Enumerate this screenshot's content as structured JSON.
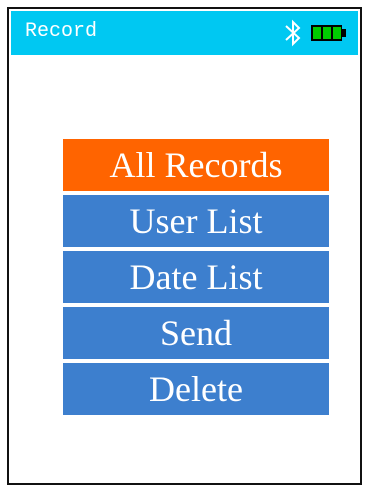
{
  "header": {
    "title": "Record",
    "icons": [
      "bluetooth-icon",
      "battery-icon"
    ]
  },
  "menu": {
    "items": [
      {
        "label": "All Records",
        "selected": true
      },
      {
        "label": "User List",
        "selected": false
      },
      {
        "label": "Date List",
        "selected": false
      },
      {
        "label": "Send",
        "selected": false
      },
      {
        "label": "Delete",
        "selected": false
      }
    ]
  },
  "battery": {
    "level": 1.0
  },
  "colors": {
    "status_bar": "#00c8f2",
    "menu_item": "#3d7fce",
    "menu_item_selected": "#ff6400",
    "battery_fill": "#00cc00",
    "frame": "#111111"
  }
}
